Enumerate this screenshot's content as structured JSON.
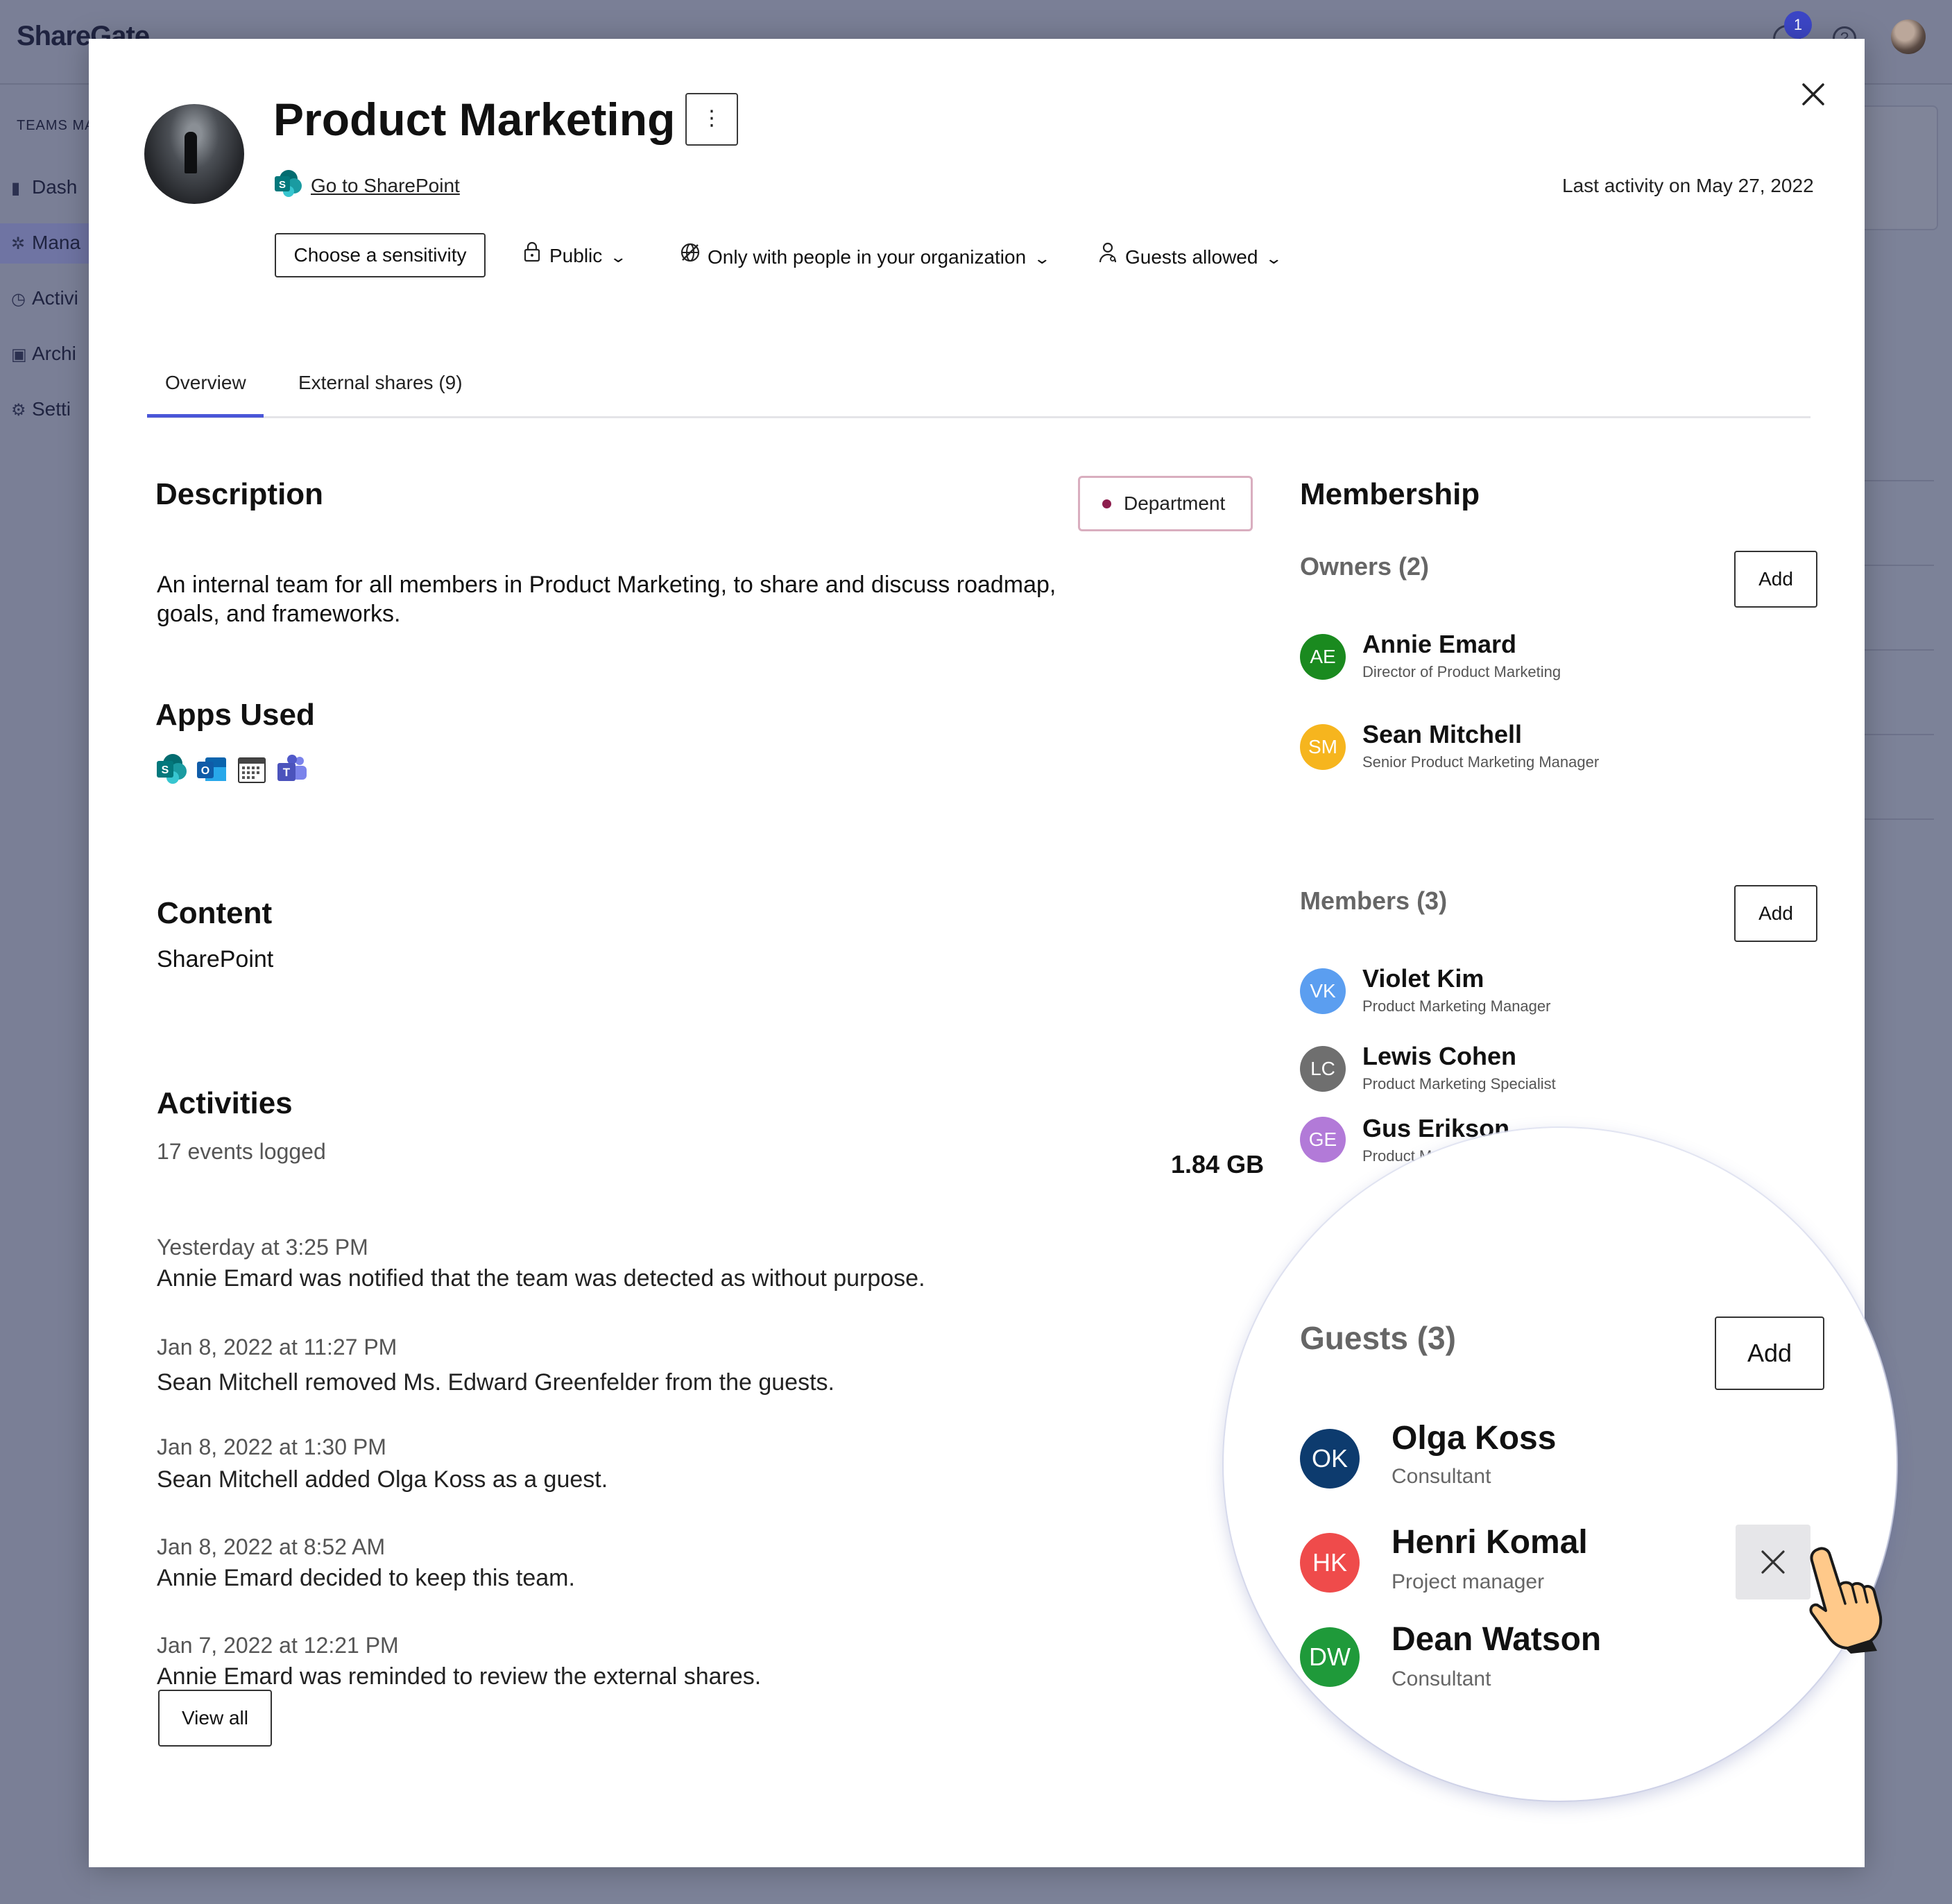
{
  "background": {
    "logo": "ShareGate",
    "notification_count": "1",
    "sidebar": {
      "title": "TEAMS MA",
      "items": [
        {
          "label": "Dash",
          "icon": "bar-chart-icon"
        },
        {
          "label": "Mana",
          "icon": "teams-icon"
        },
        {
          "label": "Activi",
          "icon": "clock-icon"
        },
        {
          "label": "Archi",
          "icon": "archive-icon"
        },
        {
          "label": "Setti",
          "icon": "gear-icon"
        }
      ]
    }
  },
  "team": {
    "title": "Product Marketing",
    "sharepoint_link": "Go to SharePoint",
    "last_activity": "Last activity on May 27, 2022",
    "sensitivity_button": "Choose a sensitivity",
    "privacy": "Public",
    "sharing": "Only with people in your organization",
    "guests": "Guests allowed"
  },
  "tabs": [
    {
      "label": "Overview",
      "active": true
    },
    {
      "label": "External shares (9)",
      "active": false
    }
  ],
  "description": {
    "heading": "Description",
    "badge": "Department",
    "badge_color": "#8d1d4d",
    "text": "An internal team for all members in Product Marketing, to share and discuss roadmap, goals, and frameworks."
  },
  "apps": {
    "heading": "Apps Used",
    "items": [
      "sharepoint-icon",
      "outlook-icon",
      "calendar-icon",
      "teams-icon"
    ]
  },
  "content": {
    "heading": "Content",
    "value": "SharePoint",
    "size": "1.84 GB"
  },
  "activities": {
    "heading": "Activities",
    "count": "17 events logged",
    "items": [
      {
        "time": "Yesterday at 3:25 PM",
        "text": "Annie Emard was notified that the team was detected as without purpose."
      },
      {
        "time": "Jan 8, 2022 at 11:27 PM",
        "text": "Sean Mitchell removed Ms. Edward Greenfelder from the guests."
      },
      {
        "time": "Jan 8, 2022 at 1:30 PM",
        "text": "Sean Mitchell added Olga Koss as a guest."
      },
      {
        "time": "Jan 8, 2022 at 8:52 AM",
        "text": "Annie Emard decided to keep this team."
      },
      {
        "time": "Jan 7, 2022 at 12:21 PM",
        "text": "Annie Emard was reminded to review the external shares."
      }
    ],
    "view_all": "View all"
  },
  "membership": {
    "heading": "Membership",
    "add_label": "Add",
    "owners": {
      "title": "Owners (2)",
      "people": [
        {
          "initials": "AE",
          "name": "Annie Emard",
          "role": "Director of Product Marketing",
          "color": "#1a8a1f"
        },
        {
          "initials": "SM",
          "name": "Sean Mitchell",
          "role": "Senior Product Marketing Manager",
          "color": "#f6b51e"
        }
      ]
    },
    "members": {
      "title": "Members (3)",
      "people": [
        {
          "initials": "VK",
          "name": "Violet Kim",
          "role": "Product Marketing Manager",
          "color": "#5b9ef0"
        },
        {
          "initials": "LC",
          "name": "Lewis Cohen",
          "role": "Product Marketing Specialist",
          "color": "#6f6f6f"
        },
        {
          "initials": "GE",
          "name": "Gus Erikson",
          "role": "Product M",
          "color": "#b27ad8"
        }
      ]
    },
    "guests": {
      "title": "Guests (3)",
      "people": [
        {
          "initials": "OK",
          "name": "Olga Koss",
          "role": "Consultant",
          "color": "#0d3b6e"
        },
        {
          "initials": "HK",
          "name": "Henri Komal",
          "role": "Project manager",
          "color": "#ef4b4b"
        },
        {
          "initials": "DW",
          "name": "Dean Watson",
          "role": "Consultant",
          "color": "#1f9a3a"
        }
      ]
    }
  }
}
